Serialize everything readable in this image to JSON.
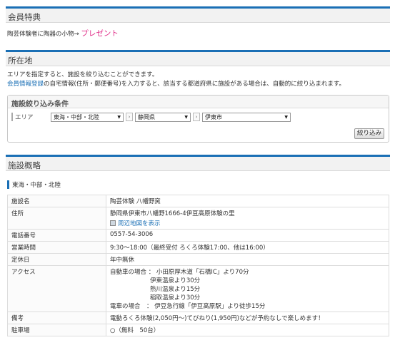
{
  "benefits": {
    "title": "会員特典",
    "text": "陶芸体験者に陶器の小物→",
    "highlight": "プレゼント"
  },
  "location": {
    "title": "所在地",
    "desc1": "エリアを指定すると、施設を絞り込むことができます。",
    "desc2_link": "会員情報登録",
    "desc2_rest": "の自宅情報(住所・郵便番号)を入力すると、該当する都道府県に施設がある場合は、自動的に絞り込まれます。"
  },
  "filter": {
    "title": "施設絞り込み条件",
    "area_label": "エリア",
    "select1": "東海・中部・北陸",
    "select2": "静岡県",
    "select3": "伊東市",
    "button": "絞り込み"
  },
  "overview": {
    "title": "施設概略",
    "region": "東海・中部・北陸",
    "rows": {
      "name_label": "施設名",
      "name": "陶芸体験 八幡野窯",
      "addr_label": "住所",
      "addr": "静岡県伊東市八幡野1666-4伊豆高原体験の里",
      "map_link": "周辺地図を表示",
      "tel_label": "電話番号",
      "tel": "0557-54-3006",
      "hours_label": "営業時間",
      "hours": "9:30～18:00（最終受付 ろくろ体験17:00、他は16:00）",
      "holiday_label": "定休日",
      "holiday": "年中無休",
      "access_label": "アクセス",
      "access1": "自動車の場合 ： 小田原厚木道「石橋IC」より70分",
      "access2": "伊東温泉より30分",
      "access3": "熱川温泉より15分",
      "access4": "稲取温泉より30分",
      "access5": "電車の場合　： 伊豆急行線「伊豆高原駅」より徒歩15分",
      "note_label": "備考",
      "note": "電動ろくろ体験(2,050円～)てびねり(1,950円)などが予約なしで楽しめます！",
      "parking_label": "駐車場",
      "parking": "○（無料　50台）"
    }
  }
}
